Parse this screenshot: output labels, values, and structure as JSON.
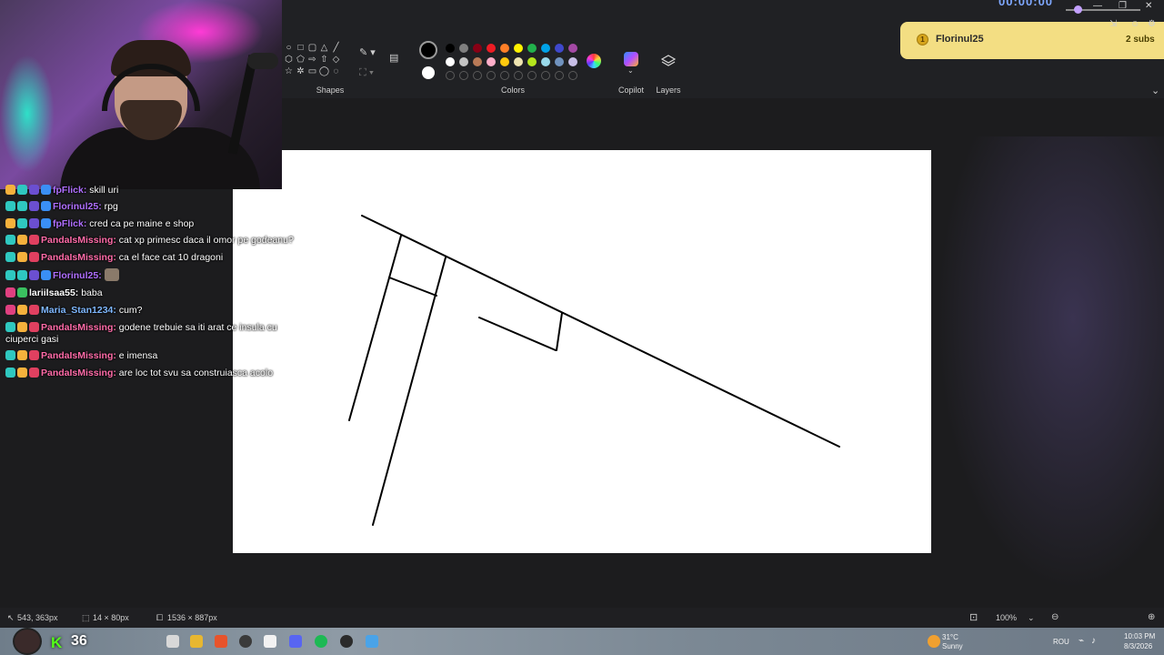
{
  "ribbon": {
    "groups": [
      {
        "label": "Shapes"
      },
      {
        "label": "Colors"
      },
      {
        "label": "Copilot"
      },
      {
        "label": "Layers"
      }
    ],
    "colors": {
      "primary": "#000000",
      "secondary": "#ffffff",
      "palette": [
        "#000000",
        "#7f7f7f",
        "#880015",
        "#ed1c24",
        "#ff7f27",
        "#fff200",
        "#22b14c",
        "#00a2e8",
        "#3f48cc",
        "#a349a4",
        "#ffffff",
        "#c3c3c3",
        "#b97a57",
        "#ffaec9",
        "#ffc90e",
        "#efe4b0",
        "#b5e61d",
        "#99d9ea",
        "#7092be",
        "#c8bfe7"
      ]
    }
  },
  "notification": {
    "tier": "1",
    "user": "Florinul25",
    "subs": "2 subs"
  },
  "timer": "00:00:00",
  "chat": [
    {
      "user": "fpFlick",
      "sep": ":",
      "text": "skill uri",
      "color": "#b06fff"
    },
    {
      "user": "Florinul25",
      "sep": ":",
      "text": "rpg",
      "color": "#b06fff"
    },
    {
      "user": "fpFlick",
      "sep": ":",
      "text": "cred ca pe maine e shop",
      "color": "#b06fff"
    },
    {
      "user": "PandaIsMissing",
      "sep": ":",
      "text": "cat xp primesc daca il omor pe godeanu?",
      "color": "#ff6ba8"
    },
    {
      "user": "PandaIsMissing",
      "sep": ":",
      "text": "ca el face cat 10 dragoni",
      "color": "#ff6ba8"
    },
    {
      "user": "Florinul25",
      "sep": ":",
      "text": "",
      "color": "#b06fff"
    },
    {
      "user": "lariilsaa55",
      "sep": ":",
      "text": "baba",
      "color": "#ffffff"
    },
    {
      "user": "Maria_Stan1234",
      "sep": ":",
      "text": "cum?",
      "color": "#7fb8ff"
    },
    {
      "user": "PandaIsMissing",
      "sep": ":",
      "text": "godene trebuie sa iti arat ce insula cu",
      "color": "#ff6ba8"
    },
    {
      "user": "",
      "sep": "",
      "text": "ciuperci gasi",
      "color": "#ffffff"
    },
    {
      "user": "PandaIsMissing",
      "sep": ":",
      "text": "e imensa",
      "color": "#ff6ba8"
    },
    {
      "user": "PandaIsMissing",
      "sep": ":",
      "text": "are loc tot svu sa construiasca acolo",
      "color": "#ff6ba8"
    }
  ],
  "status": {
    "cursor": "543, 363px",
    "selection": "14 × 80px",
    "canvas_size": "1536 × 887px",
    "zoom": "100%"
  },
  "taskbar": {
    "viewer_count": "36",
    "weather_temp": "31°C",
    "weather_desc": "Sunny",
    "lang": "ROU",
    "time": "10:03 PM",
    "date": "8/3/2026"
  }
}
